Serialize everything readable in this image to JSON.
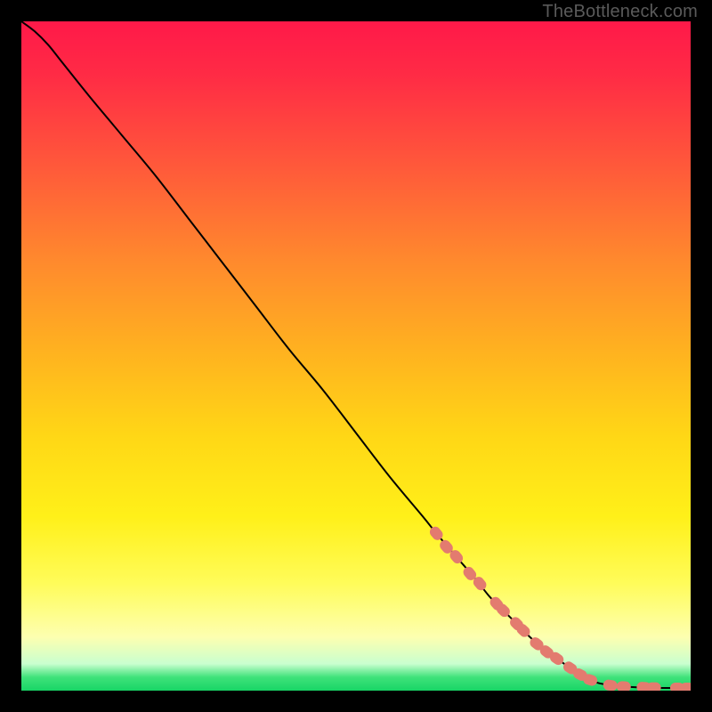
{
  "watermark": "TheBottleneck.com",
  "colors": {
    "curve": "#000000",
    "marker_fill": "#e37b6f",
    "marker_stroke": "#c96458"
  },
  "chart_data": {
    "type": "line",
    "title": "",
    "xlabel": "",
    "ylabel": "",
    "xlim": [
      0,
      100
    ],
    "ylim": [
      0,
      100
    ],
    "grid": false,
    "legend": false,
    "series": [
      {
        "name": "curve",
        "note": "Y values are read off the chart as percent of plot height (100 = top, 0 = bottom). The curve bends near x≈0–5 and again near x≈86 where it flattens to ~0.",
        "x": [
          0,
          2,
          4,
          6,
          10,
          15,
          20,
          25,
          30,
          35,
          40,
          45,
          50,
          55,
          60,
          62,
          65,
          68,
          70,
          72,
          74,
          76,
          78,
          80,
          82,
          84,
          86,
          88,
          90,
          92,
          94,
          96,
          98,
          100
        ],
        "y": [
          100,
          98.5,
          96.5,
          94,
          89,
          83,
          77,
          70.5,
          64,
          57.5,
          51,
          45,
          38.5,
          32,
          26,
          23.5,
          20,
          16.5,
          14,
          12,
          10,
          8,
          6.3,
          4.8,
          3.4,
          2.1,
          1.2,
          0.8,
          0.6,
          0.5,
          0.45,
          0.4,
          0.4,
          0.4
        ]
      }
    ],
    "markers": {
      "name": "highlighted-points",
      "note": "Pink capsule-like markers overlaid on the lower portion of the curve and along the flat tail.",
      "points": [
        {
          "x": 62,
          "y": 23.5
        },
        {
          "x": 63.5,
          "y": 21.5
        },
        {
          "x": 65,
          "y": 20
        },
        {
          "x": 67,
          "y": 17.5
        },
        {
          "x": 68.5,
          "y": 16
        },
        {
          "x": 71,
          "y": 13
        },
        {
          "x": 72,
          "y": 12
        },
        {
          "x": 74,
          "y": 10
        },
        {
          "x": 75,
          "y": 9
        },
        {
          "x": 77,
          "y": 7
        },
        {
          "x": 78.5,
          "y": 5.8
        },
        {
          "x": 80,
          "y": 4.8
        },
        {
          "x": 82,
          "y": 3.4
        },
        {
          "x": 83.5,
          "y": 2.4
        },
        {
          "x": 85,
          "y": 1.6
        },
        {
          "x": 88,
          "y": 0.8
        },
        {
          "x": 90,
          "y": 0.6
        },
        {
          "x": 93,
          "y": 0.5
        },
        {
          "x": 94.5,
          "y": 0.45
        },
        {
          "x": 98,
          "y": 0.4
        },
        {
          "x": 99.5,
          "y": 0.4
        }
      ]
    }
  }
}
